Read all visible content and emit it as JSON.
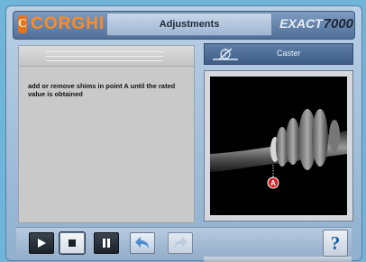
{
  "header": {
    "logo_mark": "C",
    "logo_text": "CORGHI",
    "title": "Adjustments",
    "brand_text": "EXACT",
    "brand_number": "7000"
  },
  "instruction_panel": {
    "text": "add or remove shims in point A until the rated value is obtained"
  },
  "view_panel": {
    "icon": "caster-angle-icon",
    "label": "Caster",
    "marker_label": "A"
  },
  "toolbar": {
    "buttons": [
      {
        "name": "play-icon"
      },
      {
        "name": "stop-icon"
      },
      {
        "name": "pause-icon"
      },
      {
        "name": "back-arrow-icon"
      },
      {
        "name": "forward-arrow-icon"
      }
    ],
    "help_label": "?"
  },
  "colors": {
    "accent_orange": "#ff8a1e",
    "marker_red": "#d4262c",
    "help_blue": "#1d5ea8"
  }
}
